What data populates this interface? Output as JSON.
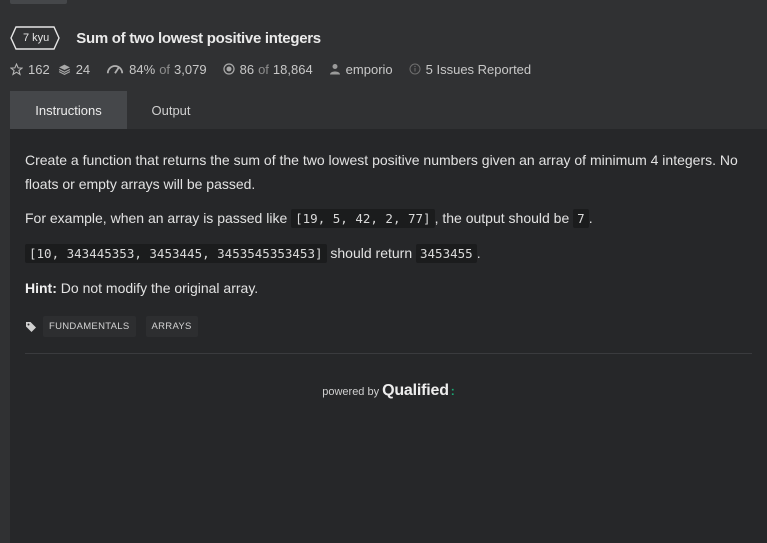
{
  "kata": {
    "rank": "7 kyu",
    "title": "Sum of two lowest positive integers"
  },
  "stats": {
    "stars": "162",
    "collections": "24",
    "satisfaction": "84%",
    "satisfaction_of": "of",
    "votes": "3,079",
    "completed": "86",
    "completed_of": "of",
    "attempts": "18,864",
    "author": "emporio",
    "issues": "5 Issues Reported"
  },
  "tabs": {
    "instructions": "Instructions",
    "output": "Output"
  },
  "description": {
    "p1": "Create a function that returns the sum of the two lowest positive numbers given an array of minimum 4 integers. No floats or empty arrays will be passed.",
    "p2_before": "For example, when an array is passed like ",
    "p2_code1": "[19, 5, 42, 2, 77]",
    "p2_middle": ", the output should be ",
    "p2_code2": "7",
    "p2_after": ".",
    "p3_code1": "[10, 343445353, 3453445, 3453545353453]",
    "p3_middle": " should return ",
    "p3_code2": "3453455",
    "p3_after": ".",
    "hint_label": "Hint:",
    "hint_text": " Do not modify the original array."
  },
  "tags": [
    "FUNDAMENTALS",
    "ARRAYS"
  ],
  "footer": {
    "powered_by": "powered by",
    "brand": "Qualified",
    "brand_dots": ":"
  },
  "colors": {
    "background": "#303133",
    "panel": "#262729",
    "active_tab": "#45474a",
    "brand_accent": "#19a974"
  }
}
